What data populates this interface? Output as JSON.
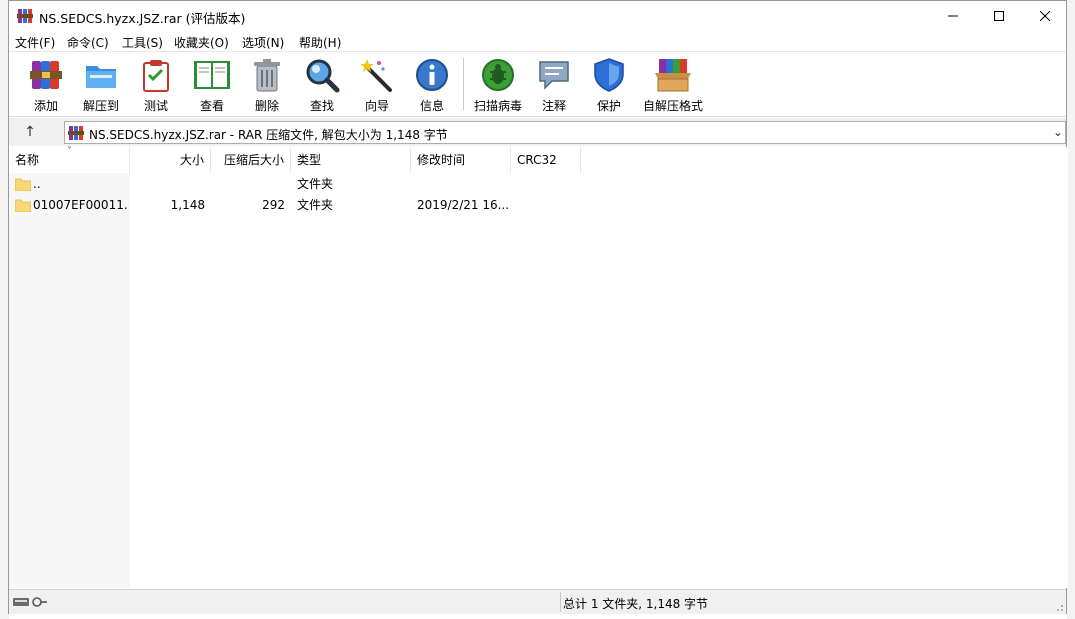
{
  "window": {
    "title": "NS.SEDCS.hyzx.JSZ.rar (评估版本)",
    "controls": [
      "minimize",
      "maximize",
      "close"
    ]
  },
  "menu": [
    {
      "label": "文件(F)"
    },
    {
      "label": "命令(C)"
    },
    {
      "label": "工具(S)"
    },
    {
      "label": "收藏夹(O)"
    },
    {
      "label": "选项(N)"
    },
    {
      "label": "帮助(H)"
    }
  ],
  "toolbar": [
    {
      "label": "添加",
      "icon": "add-archive-icon"
    },
    {
      "label": "解压到",
      "icon": "extract-to-icon"
    },
    {
      "label": "测试",
      "icon": "test-icon"
    },
    {
      "label": "查看",
      "icon": "view-book-icon"
    },
    {
      "label": "删除",
      "icon": "trash-icon"
    },
    {
      "label": "查找",
      "icon": "magnifier-icon"
    },
    {
      "label": "向导",
      "icon": "wizard-wand-icon"
    },
    {
      "label": "信息",
      "icon": "info-icon"
    },
    {
      "label": "扫描病毒",
      "icon": "virus-scan-icon"
    },
    {
      "label": "注释",
      "icon": "comment-icon"
    },
    {
      "label": "保护",
      "icon": "shield-icon"
    },
    {
      "label": "自解压格式",
      "icon": "sfx-box-icon"
    }
  ],
  "address": {
    "text": "NS.SEDCS.hyzx.JSZ.rar - RAR 压缩文件, 解包大小为 1,148 字节"
  },
  "columns": {
    "name": "名称",
    "size": "大小",
    "packed": "压缩后大小",
    "type": "类型",
    "modified": "修改时间",
    "crc": "CRC32"
  },
  "rows": [
    {
      "name": "..",
      "size": "",
      "packed": "",
      "type": "文件夹",
      "modified": "",
      "crc": ""
    },
    {
      "name": "01007EF00011...",
      "size": "1,148",
      "packed": "292",
      "type": "文件夹",
      "modified": "2019/2/21 16...",
      "crc": ""
    }
  ],
  "status": {
    "text": "总计 1 文件夹, 1,148 字节"
  },
  "colors": {
    "folder": "#f8d775",
    "shield": "#2d6fd6",
    "virus": "#3aa035"
  }
}
